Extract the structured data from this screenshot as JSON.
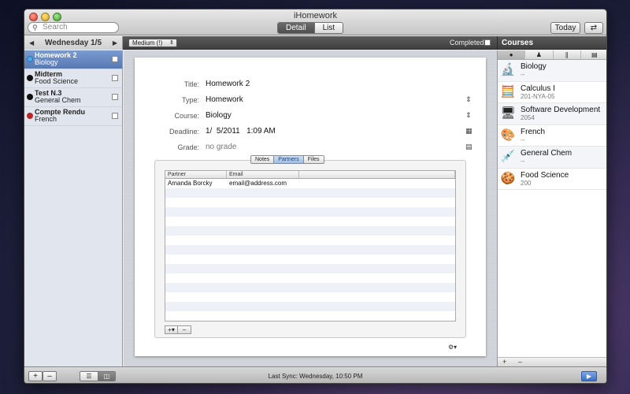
{
  "window": {
    "title": "iHomework"
  },
  "toolbar": {
    "search_placeholder": "Search",
    "view_modes": [
      {
        "label": "Detail",
        "active": true
      },
      {
        "label": "List",
        "active": false
      }
    ],
    "today_label": "Today",
    "sync_icon": "sync-icon"
  },
  "subbar": {
    "date": "Wednesday 1/5",
    "priority": "Medium (!)",
    "completed_label": "Completed",
    "courses_title": "Courses"
  },
  "tasks": [
    {
      "title": "Homework 2",
      "course": "Biology",
      "color": "#4fa8e8",
      "selected": true
    },
    {
      "title": "Midterm",
      "course": "Food Science",
      "color": "#111111",
      "selected": false
    },
    {
      "title": "Test N.3",
      "course": "General Chem",
      "color": "#111111",
      "selected": false
    },
    {
      "title": "Compte Rendu",
      "course": "French",
      "color": "#b8262a",
      "selected": false
    }
  ],
  "detail": {
    "title_label": "Title:",
    "title_value": "Homework 2",
    "type_label": "Type:",
    "type_value": "Homework",
    "course_label": "Course:",
    "course_value": "Biology",
    "deadline_label": "Deadline:",
    "deadline_value": "1/  5/2011   1:09 AM",
    "grade_label": "Grade:",
    "grade_value": "no grade",
    "tabs": [
      {
        "label": "Notes",
        "active": false
      },
      {
        "label": "Partners",
        "active": true
      },
      {
        "label": "Files",
        "active": false
      }
    ],
    "partners_columns": [
      "Partner",
      "Email"
    ],
    "partners": [
      {
        "partner": "Amanda Borcky",
        "email": "email@address.com"
      }
    ]
  },
  "courses": [
    {
      "name": "Biology",
      "code": "--",
      "icon": "microscope-icon",
      "glyph": "🔬"
    },
    {
      "name": "Calculus I",
      "code": "201-NYA-05",
      "icon": "calculator-icon",
      "glyph": "🧮"
    },
    {
      "name": "Software Development",
      "code": "2054",
      "icon": "monitor-icon",
      "glyph": "🖥"
    },
    {
      "name": "French",
      "code": "--",
      "icon": "palette-icon",
      "glyph": "🎨"
    },
    {
      "name": "General Chem",
      "code": "--",
      "icon": "syringe-icon",
      "glyph": "💉"
    },
    {
      "name": "Food Science",
      "code": "200",
      "icon": "cookie-icon",
      "glyph": "🍪"
    }
  ],
  "course_tabs": [
    "apple-icon",
    "person-icon",
    "paperclip-icon",
    "document-icon"
  ],
  "status": {
    "last_sync": "Last Sync: Wednesday, 10:50 PM"
  },
  "colors": {
    "selection": "#5878b2",
    "accent_blue": "#3c6fc2"
  }
}
